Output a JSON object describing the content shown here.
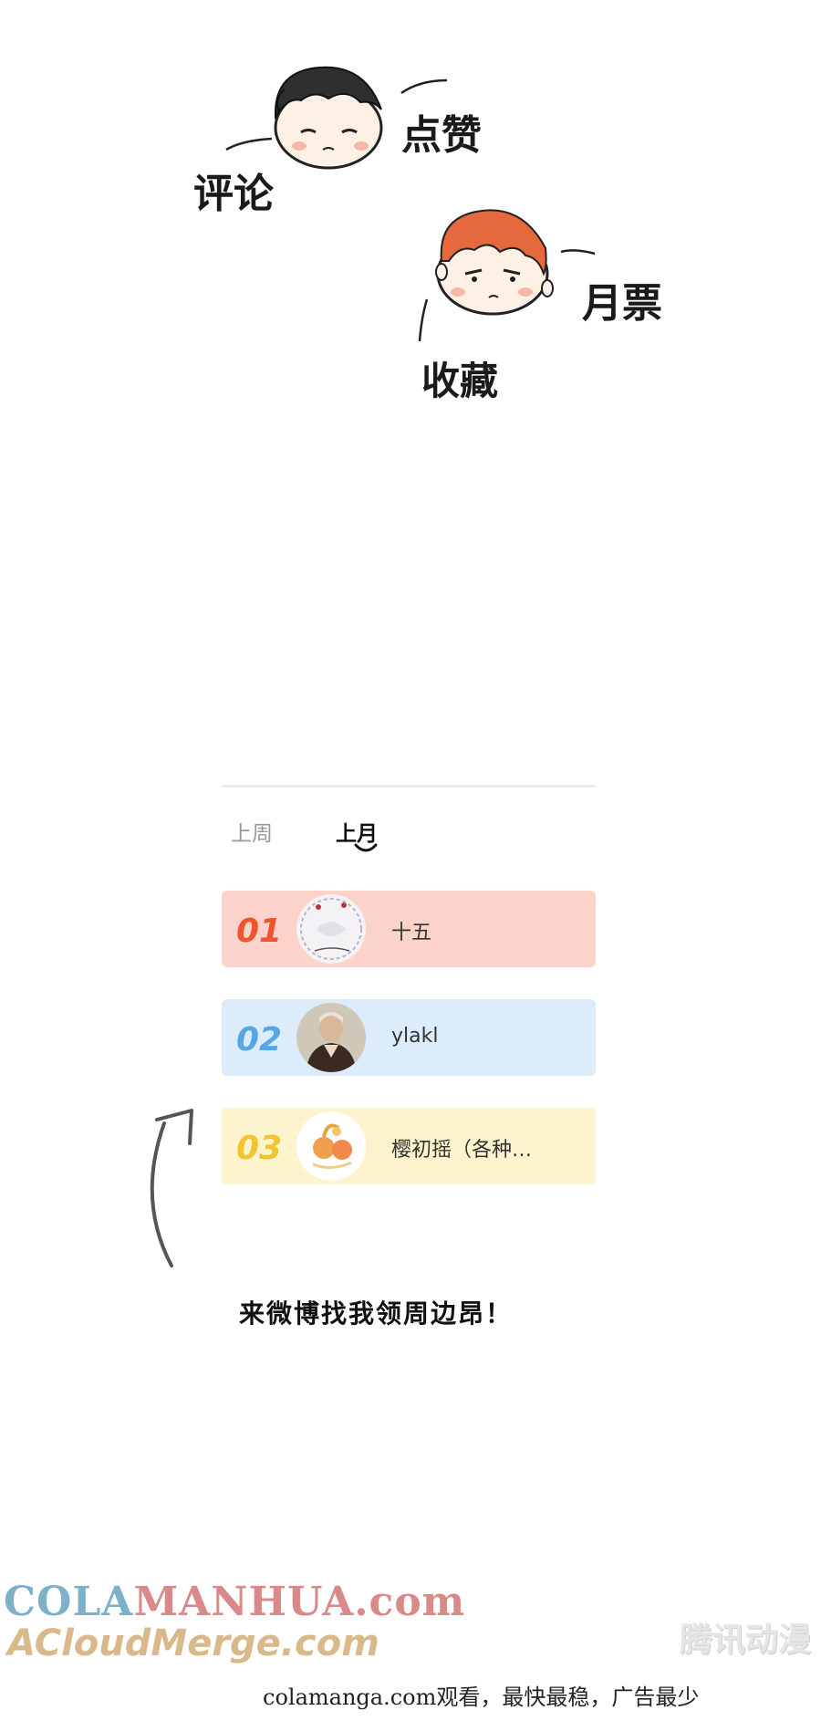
{
  "illustration": {
    "like_label": "点赞",
    "comment_label": "评论",
    "monthly_ticket_label": "月票",
    "collect_label": "收藏"
  },
  "ranking": {
    "tabs": [
      {
        "label": "上周",
        "selected": false
      },
      {
        "label": "上月",
        "selected": true
      }
    ],
    "rows": [
      {
        "rank": "01",
        "name": "十五",
        "color": "#fbd3cb",
        "accent": "#f0542e"
      },
      {
        "rank": "02",
        "name": "ylakl",
        "color": "#dcecfa",
        "accent": "#55a8e3"
      },
      {
        "rank": "03",
        "name": "樱初摇（各种…",
        "color": "#fdf3cc",
        "accent": "#f3c432"
      }
    ]
  },
  "caption": "来微博找我领周边昂！",
  "watermarks": {
    "cola_part1": "COLA",
    "cola_part2": "MANHUA.com",
    "acloud": "ACloudMerge.com",
    "tencent": "腾讯动漫"
  },
  "footer_note": "colamanga.com观看，最快最稳，广告最少"
}
